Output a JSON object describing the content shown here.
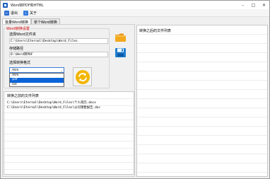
{
  "window": {
    "title": "Word转PDF和HTML"
  },
  "menu": [
    {
      "label": "退出"
    },
    {
      "label": "关于"
    }
  ],
  "tabs": [
    {
      "label": "批量Word转换"
    },
    {
      "label": "单个Word转换"
    }
  ],
  "settings": {
    "group_title": "Word转换设置",
    "source_label": "选择Word文件夹",
    "source_value": "C:\\Users\\Eternal\\Desktop\\Word_Files",
    "save_label": "存储路径",
    "save_value": "D:\\Word转PDF",
    "format_label": "选择转换格式",
    "format_selected": ".htm",
    "format_options": [
      ".htm",
      ".pdf",
      ".txt"
    ]
  },
  "left_list": {
    "header": "转换之前的文件列表",
    "items": [
      "C:\\Users\\Eternal\\Desktop\\Word_Files\\个人简历.docx",
      "C:\\Users\\Eternal\\Desktop\\Word_Files\\公司销售报告.doc"
    ]
  },
  "right_list": {
    "header": "转换之后的文件列表"
  },
  "colors": {
    "accent": "#0a64d8",
    "group_title": "#d00000",
    "folder": "#f3a81e",
    "save": "#1f7fd0",
    "convert": "#f2b600"
  }
}
